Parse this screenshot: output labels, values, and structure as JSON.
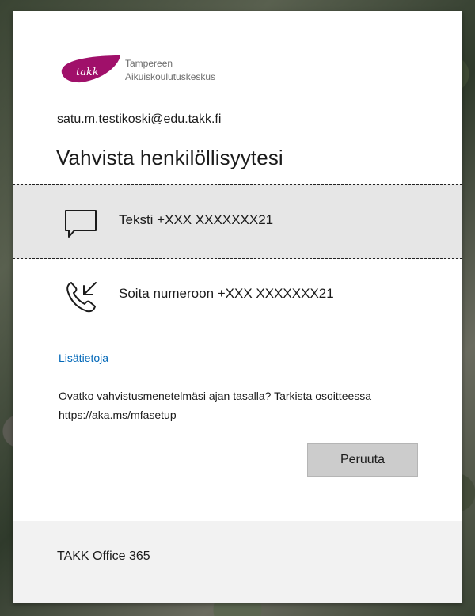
{
  "brand": {
    "logo_mark_text": "TAKK",
    "name_line1": "Tampereen",
    "name_line2": "Aikuiskoulutuskeskus",
    "color": "#a0106a"
  },
  "account": {
    "email": "satu.m.testikoski@edu.takk.fi"
  },
  "heading": "Vahvista henkilöllisyytesi",
  "options": [
    {
      "icon": "message-icon",
      "label": "Teksti +XXX XXXXXXX21",
      "selected": true
    },
    {
      "icon": "phone-call-icon",
      "label": "Soita numeroon +XXX XXXXXXX21",
      "selected": false
    }
  ],
  "more_info_link": "Lisätietoja",
  "info_text": "Ovatko vahvistusmenetelmäsi ajan tasalla? Tarkista osoitteessa https://aka.ms/mfasetup",
  "cancel_label": "Peruuta",
  "footer": {
    "text": "TAKK Office 365"
  },
  "colors": {
    "link": "#0067b8",
    "selected_bg": "#e6e6e6",
    "button_bg": "#cccccc",
    "footer_bg": "#f2f2f2"
  }
}
